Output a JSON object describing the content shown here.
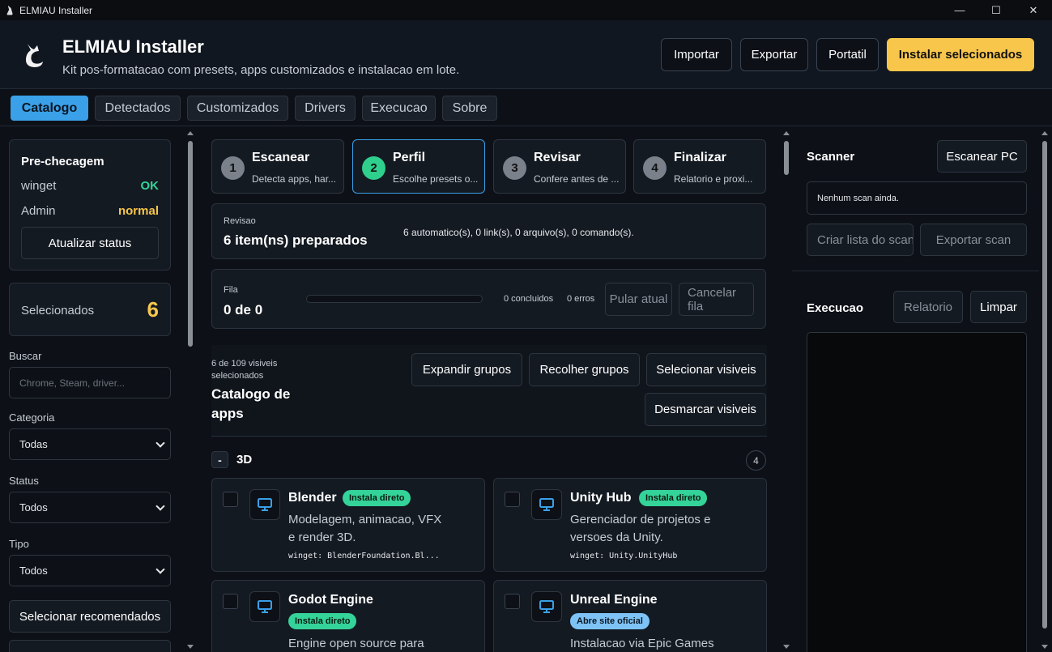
{
  "window": {
    "title": "ELMIAU Installer",
    "minimize": "—",
    "maximize": "☐",
    "close": "✕"
  },
  "header": {
    "title": "ELMIAU Installer",
    "subtitle": "Kit pos-formatacao com presets, apps customizados e instalacao em lote.",
    "buttons": {
      "import": "Importar",
      "export": "Exportar",
      "portable": "Portatil",
      "install": "Instalar selecionados"
    }
  },
  "tabs": [
    "Catalogo",
    "Detectados",
    "Customizados",
    "Drivers",
    "Execucao",
    "Sobre"
  ],
  "sidebar": {
    "precheck": {
      "title": "Pre-checagem",
      "winget_label": "winget",
      "winget_value": "OK",
      "admin_label": "Admin",
      "admin_value": "normal",
      "refresh": "Atualizar status"
    },
    "selected": {
      "label": "Selecionados",
      "count": "6"
    },
    "search": {
      "label": "Buscar",
      "placeholder": "Chrome, Steam, driver..."
    },
    "category": {
      "label": "Categoria",
      "value": "Todas"
    },
    "status": {
      "label": "Status",
      "value": "Todos"
    },
    "type": {
      "label": "Tipo",
      "value": "Todos"
    },
    "recommended": "Selecionar recomendados"
  },
  "steps": [
    {
      "num": "1",
      "title": "Escanear",
      "desc": "Detecta apps, har..."
    },
    {
      "num": "2",
      "title": "Perfil",
      "desc": "Escolhe presets o..."
    },
    {
      "num": "3",
      "title": "Revisar",
      "desc": "Confere antes de ..."
    },
    {
      "num": "4",
      "title": "Finalizar",
      "desc": "Relatorio e proxi..."
    }
  ],
  "review": {
    "label": "Revisao",
    "value": "6 item(ns) preparados",
    "detail": "6 automatico(s), 0 link(s), 0 arquivo(s), 0 comando(s)."
  },
  "queue": {
    "label": "Fila",
    "value": "0 de 0",
    "progress": 0,
    "done": "0 concluidos",
    "errors": "0 erros",
    "skip": "Pular atual",
    "cancel": "Cancelar fila"
  },
  "catalog": {
    "count": "6 de 109 visiveis selecionados",
    "title": "Catalogo de apps",
    "expand": "Expandir grupos",
    "collapse": "Recolher grupos",
    "select_visible": "Selecionar visiveis",
    "deselect_visible": "Desmarcar visiveis",
    "group": {
      "toggle": "-",
      "name": "3D",
      "count": "4"
    },
    "apps": [
      {
        "name": "Blender",
        "badge": "Instala direto",
        "desc": "Modelagem, animacao, VFX e render 3D.",
        "winget": "winget: BlenderFoundation.Bl..."
      },
      {
        "name": "Unity Hub",
        "badge": "Instala direto",
        "desc": "Gerenciador de projetos e versoes da Unity.",
        "winget": "winget: Unity.UnityHub"
      },
      {
        "name": "Godot Engine",
        "badge": "Instala direto",
        "desc": "Engine open source para"
      },
      {
        "name": "Unreal Engine",
        "badge": "Abre site oficial",
        "desc": "Instalacao via Epic Games"
      }
    ]
  },
  "scanner": {
    "title": "Scanner",
    "scan": "Escanear PC",
    "status": "Nenhum scan ainda.",
    "create_list": "Criar lista do scan",
    "export": "Exportar scan"
  },
  "execution": {
    "title": "Execucao",
    "report": "Relatorio",
    "clear": "Limpar"
  }
}
